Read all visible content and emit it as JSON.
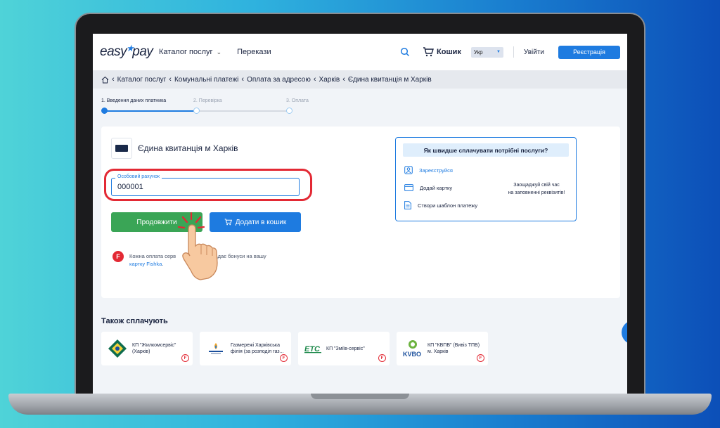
{
  "header": {
    "logo_text_1": "easy",
    "logo_text_2": "pay",
    "catalog_label": "Каталог послуг",
    "transfers_label": "Перекази",
    "cart_label": "Кошик",
    "lang_value": "Укр",
    "login_label": "Увійти",
    "register_label": "Реєстрація"
  },
  "breadcrumb": {
    "items": [
      "Каталог послуг",
      "Комунальні платежі",
      "Оплата за адресою",
      "Харків",
      "Єдина квитанція м Харків"
    ]
  },
  "steps": [
    {
      "label": "1. Введення даних платника",
      "active": true
    },
    {
      "label": "2. Перевірка",
      "active": false
    },
    {
      "label": "3. Оплата",
      "active": false
    }
  ],
  "form": {
    "provider_name": "Єдина квитанція м Харків",
    "account_label": "Особовий рахунок",
    "account_value": "000001",
    "continue_label": "Продовжити",
    "add_to_cart_label": "Додати в кошик",
    "fishka_text": "Кожна оплата серв",
    "fishka_text_2": "чкою надає бонуси на вашу",
    "fishka_link": "картку Fishka",
    "fishka_period": "."
  },
  "info_box": {
    "title": "Як швидше сплачувати потрібні послуги?",
    "rows": [
      "Зареєструйся",
      "Додай картку",
      "Створи шаблон платежу"
    ],
    "side_line_1": "Заощаджуй свій час",
    "side_line_2": "на заповненні реквізитів!"
  },
  "also_pay": {
    "title": "Також сплачують",
    "tiles": [
      {
        "name": "КП \"Жилкомсервіс\" (Харків)"
      },
      {
        "name": "Газмережі Харківська філія (за розподіл газ..."
      },
      {
        "name": "КП \"Зміїв-сервіс\""
      },
      {
        "name": "КП \"КВПВ\" (Вивіз ТПВ) м. Харків"
      }
    ]
  },
  "colors": {
    "accent": "#1e7be0",
    "continue": "#3aa556",
    "highlight": "#e32934"
  }
}
